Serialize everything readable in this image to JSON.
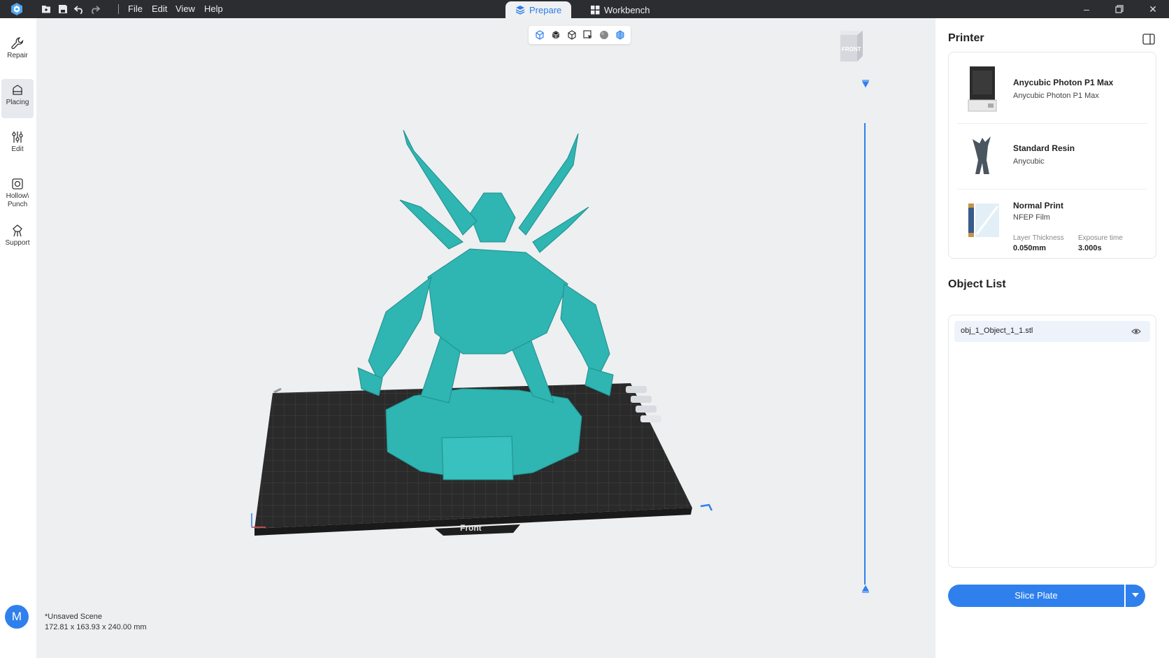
{
  "titlebar": {
    "menus": [
      "File",
      "Edit",
      "View",
      "Help"
    ],
    "tabs": [
      {
        "label": "Prepare",
        "active": true
      },
      {
        "label": "Workbench",
        "active": false
      }
    ]
  },
  "tools": [
    {
      "label": "Repair",
      "icon": "wrench-icon"
    },
    {
      "label": "Placing",
      "icon": "placing-icon",
      "active": true
    },
    {
      "label": "Edit",
      "icon": "sliders-icon"
    },
    {
      "label": "Hollow\\\nPunch",
      "icon": "hollow-icon"
    },
    {
      "label": "Support",
      "icon": "support-icon"
    }
  ],
  "user": {
    "avatar_letter": "M"
  },
  "viewport": {
    "plate_label": "Front",
    "view_cube_label": "FRONT",
    "scene_name": "*Unsaved Scene",
    "scene_dims": "172.81 x 163.93 x 240.00 mm",
    "model_color": "#2fb5b2"
  },
  "printer_panel": {
    "title": "Printer",
    "printer_name": "Anycubic Photon P1 Max",
    "printer_sub": "Anycubic Photon P1 Max",
    "resin_name": "Standard Resin",
    "resin_sub": "Anycubic",
    "profile_name": "Normal Print",
    "profile_sub": "NFEP Film",
    "layer_label": "Layer Thickness",
    "layer_value": "0.050mm",
    "exposure_label": "Exposure time",
    "exposure_value": "3.000s"
  },
  "object_list": {
    "title": "Object List",
    "items": [
      "obj_1_Object_1_1.stl"
    ]
  },
  "actions": {
    "slice_label": "Slice Plate"
  },
  "colors": {
    "accent": "#2f80ed",
    "titlebar": "#2b2d31"
  }
}
